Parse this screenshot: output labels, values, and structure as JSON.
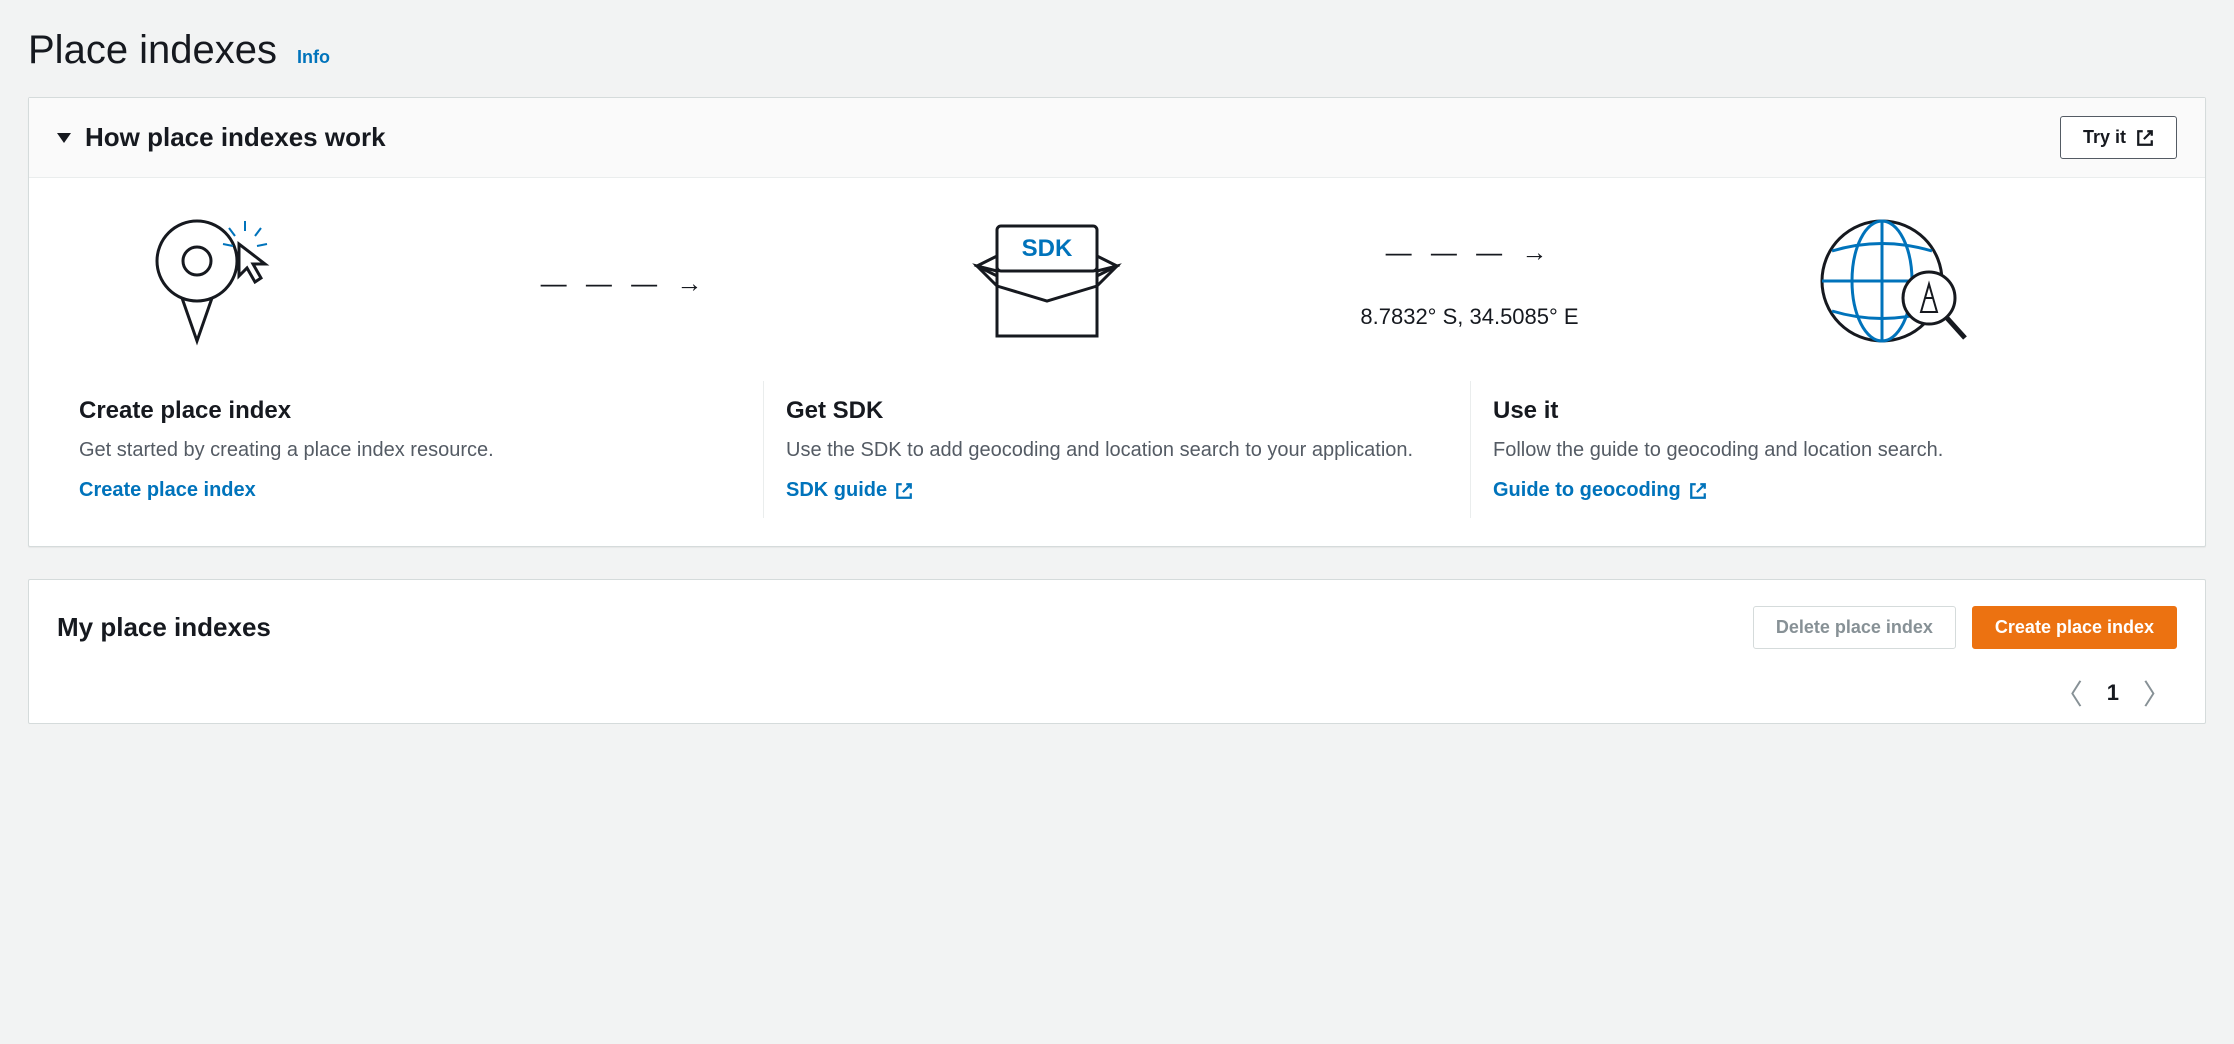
{
  "header": {
    "title": "Place indexes",
    "info_label": "Info"
  },
  "how_panel": {
    "title": "How place indexes work",
    "try_it_label": "Try it",
    "coordinates": "8.7832° S, 34.5085° E",
    "sdk_box_label": "SDK",
    "steps": [
      {
        "title": "Create place index",
        "desc": "Get started by creating a place index resource.",
        "link_label": "Create place index"
      },
      {
        "title": "Get SDK",
        "desc": "Use the SDK to add geocoding and location search to your application.",
        "link_label": "SDK guide"
      },
      {
        "title": "Use it",
        "desc": "Follow the guide to geocoding and location search.",
        "link_label": "Guide to geocoding"
      }
    ]
  },
  "my_panel": {
    "title": "My place indexes",
    "delete_label": "Delete place index",
    "create_label": "Create place index",
    "page": "1"
  }
}
